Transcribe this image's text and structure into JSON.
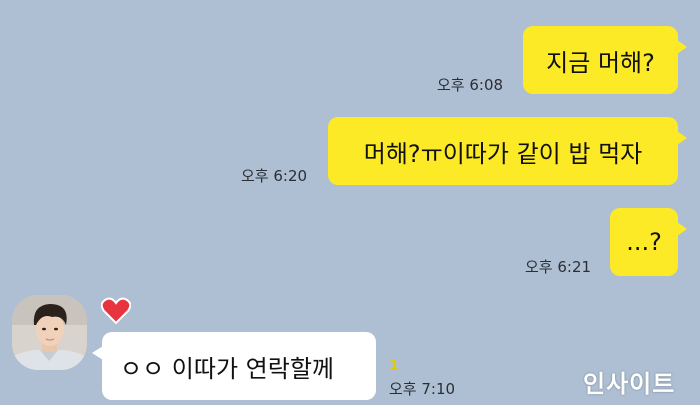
{
  "messages": [
    {
      "direction": "sent",
      "text": "지금 머해?",
      "time": "오후 6:08"
    },
    {
      "direction": "sent",
      "text": "머해?ㅠ이따가 같이 밥 먹자",
      "time": "오후 6:20"
    },
    {
      "direction": "sent",
      "text": "...?",
      "time": "오후 6:21"
    },
    {
      "direction": "received",
      "text": "ㅇㅇ 이따가 연락할께",
      "time": "오후 7:10",
      "unread_count": "1"
    }
  ],
  "watermark": "인사이트",
  "icons": {
    "heart": "heart-icon",
    "avatar": "profile-avatar"
  },
  "colors": {
    "background": "#aebfd3",
    "sent_bubble": "#fcea27",
    "received_bubble": "#ffffff",
    "unread": "#e3c800",
    "heart": "#e8343e"
  }
}
